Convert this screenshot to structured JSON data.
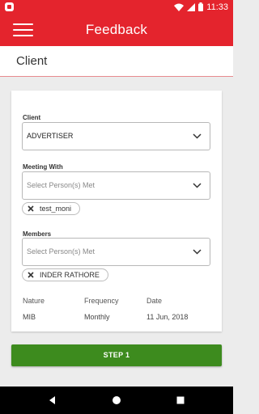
{
  "status_bar": {
    "time": "11:33",
    "icons": [
      "app-notification-icon",
      "wifi-icon",
      "signal-icon",
      "battery-icon"
    ]
  },
  "app_bar": {
    "title": "Feedback",
    "menu_icon": "hamburger-menu-icon"
  },
  "section": {
    "title": "Client"
  },
  "form": {
    "client": {
      "label": "Client",
      "value": "ADVERTISER"
    },
    "meeting_with": {
      "label": "Meeting With",
      "placeholder": "Select Person(s) Met",
      "chips": [
        "test_moni"
      ]
    },
    "members": {
      "label": "Members",
      "placeholder": "Select Person(s) Met",
      "chips": [
        "INDER RATHORE"
      ]
    },
    "info": {
      "nature_label": "Nature",
      "nature_value": "MIB",
      "frequency_label": "Frequency",
      "frequency_value": "Monthly",
      "date_label": "Date",
      "date_value": "11 Jun, 2018"
    }
  },
  "actions": {
    "step_label": "STEP 1"
  },
  "nav_bar": {
    "buttons": [
      "back-icon",
      "home-icon",
      "recents-icon"
    ]
  },
  "colors": {
    "primary": "#e4242d",
    "button_green": "#3d8b1e",
    "background": "#ececec"
  }
}
